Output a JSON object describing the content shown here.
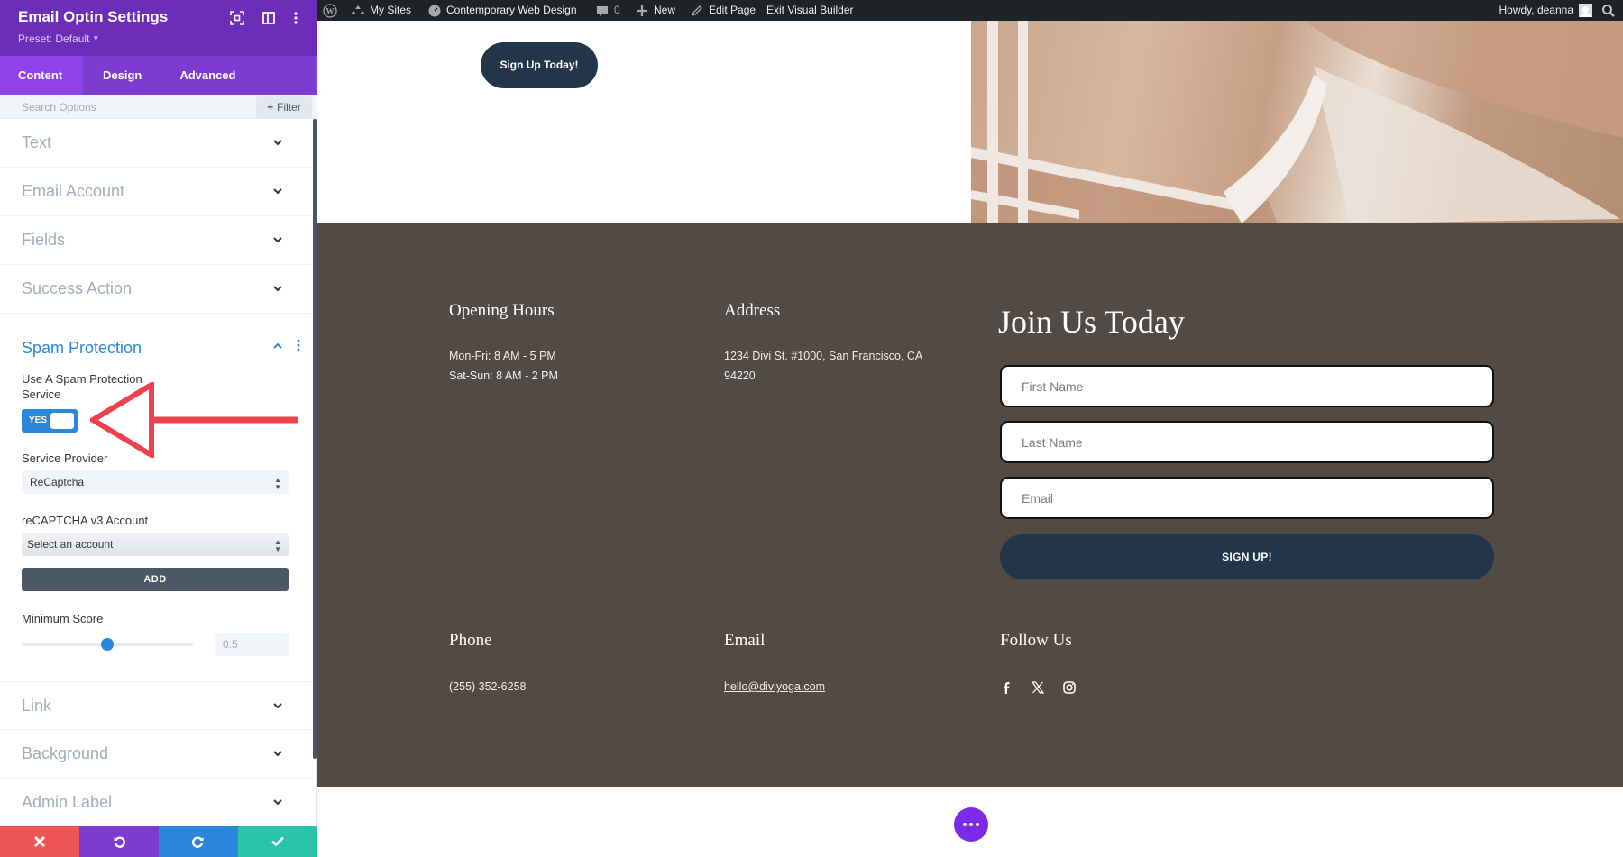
{
  "panel": {
    "title": "Email Optin Settings",
    "preset": "Preset: Default",
    "header_icons": [
      "expand-icon",
      "sidebar-layout-icon",
      "more-options-icon"
    ],
    "tabs": [
      {
        "label": "Content",
        "active": true
      },
      {
        "label": "Design",
        "active": false
      },
      {
        "label": "Advanced",
        "active": false
      }
    ],
    "search": {
      "placeholder": "Search Options",
      "value": ""
    },
    "filter_label": "Filter",
    "sections_before": [
      {
        "label": "Text"
      },
      {
        "label": "Email Account"
      },
      {
        "label": "Fields"
      },
      {
        "label": "Success Action"
      }
    ],
    "spam": {
      "title": "Spam Protection",
      "use_service_label": "Use A Spam Protection Service",
      "toggle_value": "YES",
      "toggle_on": true,
      "service_provider_label": "Service Provider",
      "service_provider_value": "ReCaptcha",
      "account_label": "reCAPTCHA v3 Account",
      "account_value": "Select an account",
      "add_label": "ADD",
      "min_score_label": "Minimum Score",
      "min_score_value": "0.5",
      "min_score_fraction": 0.5
    },
    "sections_after": [
      {
        "label": "Link"
      },
      {
        "label": "Background"
      },
      {
        "label": "Admin Label"
      }
    ],
    "bottom_bar": [
      {
        "name": "discard-button",
        "icon": "close-icon",
        "color": "#ef5555"
      },
      {
        "name": "undo-button",
        "icon": "undo-icon",
        "color": "#7e3bd0"
      },
      {
        "name": "redo-button",
        "icon": "redo-icon",
        "color": "#2b87da"
      },
      {
        "name": "save-button",
        "icon": "check-icon",
        "color": "#29c4a9"
      }
    ],
    "annotation_color": "#f0424d"
  },
  "adminbar": {
    "my_sites": "My Sites",
    "site_name": "Contemporary Web Design",
    "comments_count": "0",
    "new_label": "New",
    "edit_page": "Edit Page",
    "exit_builder": "Exit Visual Builder",
    "howdy": "Howdy, deanna"
  },
  "page": {
    "signup_today": "Sign Up Today!",
    "footer": {
      "opening_hours_title": "Opening Hours",
      "hours": [
        "Mon-Fri: 8 AM - 5 PM",
        "Sat-Sun: 8 AM - 2 PM"
      ],
      "address_title": "Address",
      "address_lines": [
        "1234 Divi St. #1000, San Francisco, CA",
        "94220"
      ],
      "phone_title": "Phone",
      "phone": "(255) 352-6258",
      "email_title": "Email",
      "email": "hello@diviyoga.com",
      "follow_title": "Follow Us",
      "social": [
        "facebook-icon",
        "x-twitter-icon",
        "instagram-icon"
      ]
    },
    "optin": {
      "title": "Join Us Today",
      "first_name_placeholder": "First Name",
      "last_name_placeholder": "Last Name",
      "email_placeholder": "Email",
      "button": "SIGN UP!"
    },
    "colors": {
      "footer_bg": "#524a45",
      "button_bg": "#233548",
      "builder_purple": "#7d2ae8"
    }
  }
}
